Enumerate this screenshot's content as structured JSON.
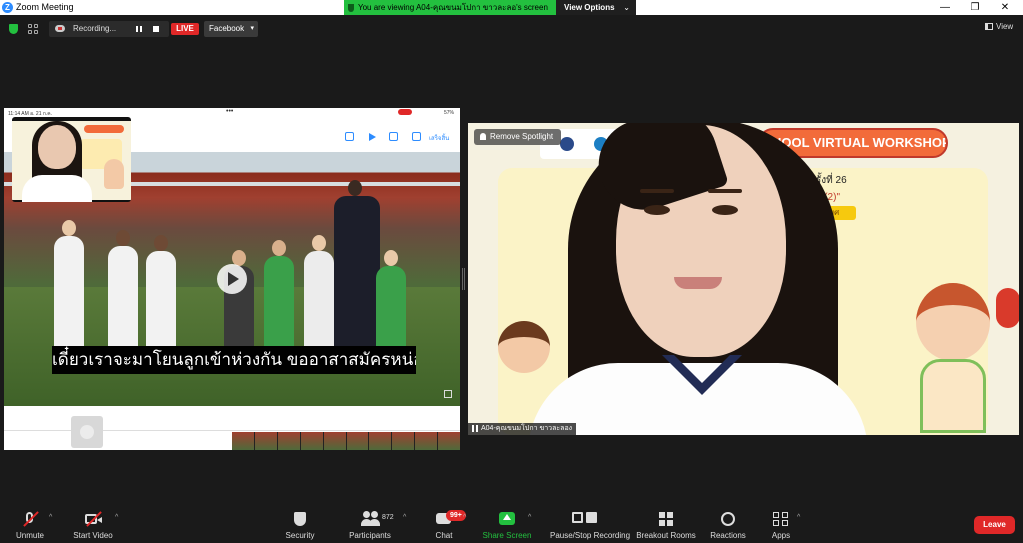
{
  "window": {
    "title": "Zoom Meeting",
    "logo_letter": "Z",
    "controls": {
      "minimize": "—",
      "maximize": "❐",
      "close": "✕"
    }
  },
  "view_banner": {
    "message": "You are viewing A04-คุณขนมโปกา ขาวละลอ's screen",
    "options_label": "View Options",
    "chevron": "⌄"
  },
  "top_bar": {
    "recording_text": "Recording...",
    "live_label": "LIVE",
    "facebook_label": "Facebook",
    "facebook_chevron": "▾",
    "view_label": "View"
  },
  "shared_screen": {
    "status_time": "11:14 AM  อ. 21 ก.ค.",
    "status_battery": "57%",
    "dots": "•••",
    "done_label": "เสร็จสิ้น",
    "subtitle": "เดี๋ยวเราจะมาโยนลูกเข้าห่วงกัน ขออาสาสมัครหน่อย"
  },
  "speaker": {
    "workshop_banner": "HOOL VIRTUAL WORKSHOP",
    "slide_line1": "อมัย ครั้งที่ 26",
    "slide_line2": "ทางเพศ (2)\"",
    "slide_tag": "ละเมิดทางเพศ",
    "remove_spotlight": "Remove Spotlight",
    "name_label": "A04-คุณขนมโปกา ขาวละลอง"
  },
  "toolbar": {
    "unmute": "Unmute",
    "start_video": "Start Video",
    "security": "Security",
    "participants": "Participants",
    "participants_count": "872",
    "chat": "Chat",
    "chat_badge": "99+",
    "share_screen": "Share Screen",
    "pause_stop": "Pause/Stop Recording",
    "breakout": "Breakout Rooms",
    "reactions": "Reactions",
    "apps": "Apps",
    "leave": "Leave",
    "caret": "^"
  }
}
